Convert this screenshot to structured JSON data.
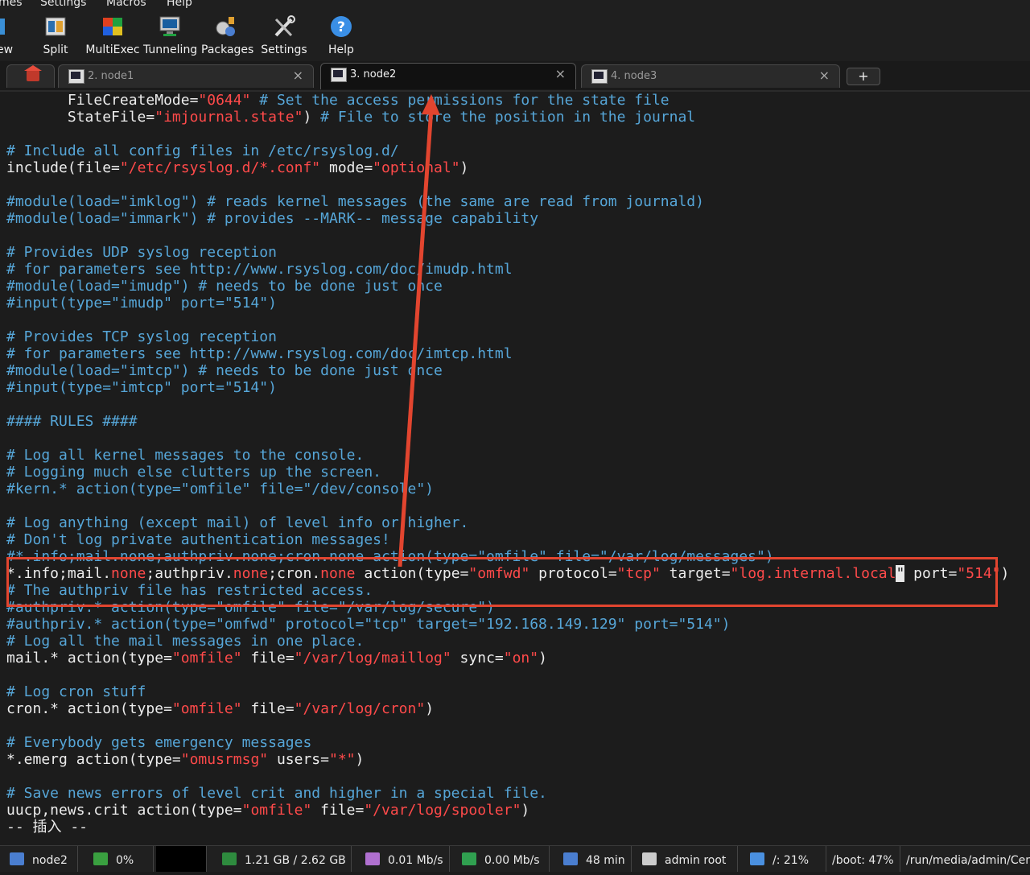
{
  "menu": [
    "mes",
    "Settings",
    "Macros",
    "Help"
  ],
  "toolbar": [
    {
      "label": "ew",
      "icon": "view-icon"
    },
    {
      "label": "Split",
      "icon": "split-icon"
    },
    {
      "label": "MultiExec",
      "icon": "multiexec-icon"
    },
    {
      "label": "Tunneling",
      "icon": "tunneling-icon"
    },
    {
      "label": "Packages",
      "icon": "packages-icon"
    },
    {
      "label": "Settings",
      "icon": "settings-icon"
    },
    {
      "label": "Help",
      "icon": "help-icon"
    }
  ],
  "tabs": [
    {
      "label": "2. node1",
      "active": false
    },
    {
      "label": "3. node2",
      "active": true
    },
    {
      "label": "4. node3",
      "active": false
    }
  ],
  "tab_close_glyph": "×",
  "new_tab_glyph": "+",
  "terminal": {
    "lines": [
      [
        {
          "t": "       FileCreateMode="
        },
        {
          "t": "\"0644\"",
          "k": "s"
        },
        {
          "t": " # Set the access permissions for the state file",
          "k": "c"
        }
      ],
      [
        {
          "t": "       StateFile="
        },
        {
          "t": "\"imjournal.state\"",
          "k": "s"
        },
        {
          "t": ") "
        },
        {
          "t": "# File to store the position in the journal",
          "k": "c"
        }
      ],
      [],
      [
        {
          "t": "# Include all config files in /etc/rsyslog.d/",
          "k": "c"
        }
      ],
      [
        {
          "t": "include(file="
        },
        {
          "t": "\"/etc/rsyslog.d/*.conf\"",
          "k": "s"
        },
        {
          "t": " mode="
        },
        {
          "t": "\"optional\"",
          "k": "s"
        },
        {
          "t": ")"
        }
      ],
      [],
      [
        {
          "t": "#module(load=\"imklog\") # reads kernel messages (the same are read from journald)",
          "k": "c"
        }
      ],
      [
        {
          "t": "#module(load=\"immark\") # provides --MARK-- message capability",
          "k": "c"
        }
      ],
      [],
      [
        {
          "t": "# Provides UDP syslog reception",
          "k": "c"
        }
      ],
      [
        {
          "t": "# for parameters see http://www.rsyslog.com/doc/imudp.html",
          "k": "c"
        }
      ],
      [
        {
          "t": "#module(load=\"imudp\") # needs to be done just once",
          "k": "c"
        }
      ],
      [
        {
          "t": "#input(type=\"imudp\" port=\"514\")",
          "k": "c"
        }
      ],
      [],
      [
        {
          "t": "# Provides TCP syslog reception",
          "k": "c"
        }
      ],
      [
        {
          "t": "# for parameters see http://www.rsyslog.com/doc/imtcp.html",
          "k": "c"
        }
      ],
      [
        {
          "t": "#module(load=\"imtcp\") # needs to be done just once",
          "k": "c"
        }
      ],
      [
        {
          "t": "#input(type=\"imtcp\" port=\"514\")",
          "k": "c"
        }
      ],
      [],
      [
        {
          "t": "#### RULES ####",
          "k": "c"
        }
      ],
      [],
      [
        {
          "t": "# Log all kernel messages to the console.",
          "k": "c"
        }
      ],
      [
        {
          "t": "# Logging much else clutters up the screen.",
          "k": "c"
        }
      ],
      [
        {
          "t": "#kern.* action(type=\"omfile\" file=\"/dev/console\")",
          "k": "c"
        }
      ],
      [],
      [
        {
          "t": "# Log anything (except mail) of level info or higher.",
          "k": "c"
        }
      ],
      [
        {
          "t": "# Don't log private authentication messages!",
          "k": "c"
        }
      ],
      [
        {
          "t": "#*.info;mail.none;authpriv.none;cron.none action(type=\"omfile\" file=\"/var/log/messages\")",
          "k": "c"
        }
      ],
      [
        {
          "t": "*.info;mail."
        },
        {
          "t": "none",
          "k": "s"
        },
        {
          "t": ";authpriv."
        },
        {
          "t": "none",
          "k": "s"
        },
        {
          "t": ";cron."
        },
        {
          "t": "none",
          "k": "s"
        },
        {
          "t": " action(type="
        },
        {
          "t": "\"omfwd\"",
          "k": "s"
        },
        {
          "t": " protocol="
        },
        {
          "t": "\"tcp\"",
          "k": "s"
        },
        {
          "t": " target="
        },
        {
          "t": "\"log.internal.local",
          "k": "s"
        },
        {
          "t": "\"",
          "k": "cursor"
        },
        {
          "t": " port="
        },
        {
          "t": "\"514\"",
          "k": "s"
        },
        {
          "t": ")"
        }
      ],
      [
        {
          "t": "# The authpriv file has restricted access.",
          "k": "c"
        }
      ],
      [
        {
          "t": "#authpriv.* action(type=\"omfile\" file=\"/var/log/secure\")",
          "k": "c"
        }
      ],
      [
        {
          "t": "#authpriv.* action(type=\"omfwd\" protocol=\"tcp\" target=\"192.168.149.129\" port=\"514\")",
          "k": "c"
        }
      ],
      [
        {
          "t": "# Log all the mail messages in one place.",
          "k": "c"
        }
      ],
      [
        {
          "t": "mail.* action(type="
        },
        {
          "t": "\"omfile\"",
          "k": "s"
        },
        {
          "t": " file="
        },
        {
          "t": "\"/var/log/maillog\"",
          "k": "s"
        },
        {
          "t": " sync="
        },
        {
          "t": "\"on\"",
          "k": "s"
        },
        {
          "t": ")"
        }
      ],
      [],
      [
        {
          "t": "# Log cron stuff",
          "k": "c"
        }
      ],
      [
        {
          "t": "cron.* action(type="
        },
        {
          "t": "\"omfile\"",
          "k": "s"
        },
        {
          "t": " file="
        },
        {
          "t": "\"/var/log/cron\"",
          "k": "s"
        },
        {
          "t": ")"
        }
      ],
      [],
      [
        {
          "t": "# Everybody gets emergency messages",
          "k": "c"
        }
      ],
      [
        {
          "t": "*.emerg action(type="
        },
        {
          "t": "\"omusrmsg\"",
          "k": "s"
        },
        {
          "t": " users="
        },
        {
          "t": "\"*\"",
          "k": "s"
        },
        {
          "t": ")"
        }
      ],
      [],
      [
        {
          "t": "# Save news errors of level crit and higher in a special file.",
          "k": "c"
        }
      ],
      [
        {
          "t": "uucp,news.crit action(type="
        },
        {
          "t": "\"omfile\"",
          "k": "s"
        },
        {
          "t": " file="
        },
        {
          "t": "\"/var/log/spooler\"",
          "k": "s"
        },
        {
          "t": ")"
        }
      ],
      [
        {
          "t": "-- 插入 --"
        }
      ]
    ]
  },
  "annotation_color": "#e2452f",
  "status": [
    {
      "text": "node2",
      "icon": "server-icon"
    },
    {
      "text": "0%",
      "icon": "cpu-icon"
    },
    {
      "text": "",
      "icon": ""
    },
    {
      "text": "1.21 GB / 2.62 GB",
      "icon": "memory-icon"
    },
    {
      "text": "0.01 Mb/s",
      "icon": "upload-icon"
    },
    {
      "text": "0.00 Mb/s",
      "icon": "download-icon"
    },
    {
      "text": "48 min",
      "icon": "uptime-icon"
    },
    {
      "text": "admin  root",
      "icon": "user-icon"
    },
    {
      "text": "/: 21%",
      "icon": "disk-icon"
    },
    {
      "text": "/boot: 47%",
      "icon": ""
    },
    {
      "text": "/run/media/admin/Cent",
      "icon": ""
    }
  ]
}
